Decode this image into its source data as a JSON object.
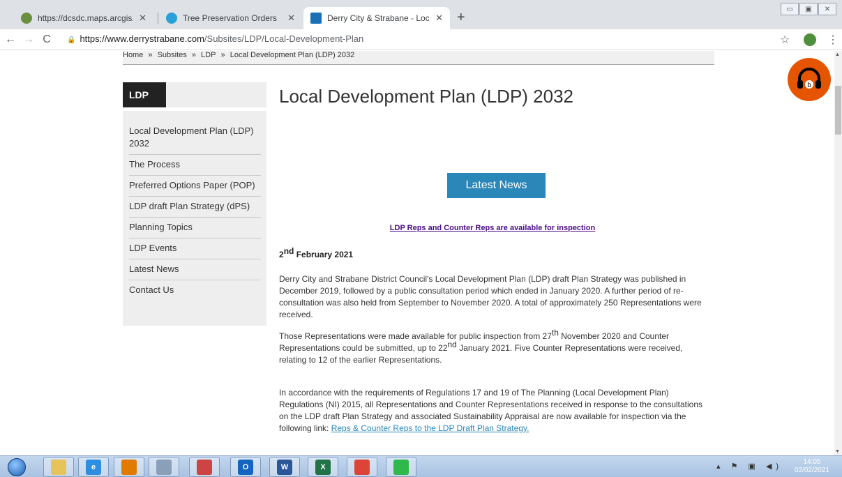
{
  "browser": {
    "tabs": [
      {
        "title": "https://dcsdc.maps.arcgis.com/ap",
        "color": "#6a8f3e"
      },
      {
        "title": "Tree Preservation Orders",
        "color": "#2aa0d8"
      },
      {
        "title": "Derry City & Strabane - Local De",
        "color": "#1a6fb5"
      }
    ],
    "new_tab": "+",
    "url_host": "https://www.derrystrabane.com",
    "url_path": "/Subsites/LDP/Local-Development-Plan"
  },
  "breadcrumb": [
    "Home",
    "»",
    "Subsites",
    "»",
    "LDP",
    "»",
    "Local Development Plan (LDP) 2032"
  ],
  "sidebar": {
    "heading": "LDP",
    "items": [
      "Local Development Plan (LDP) 2032",
      "The Process",
      "Preferred Options Paper (POP)",
      "LDP draft Plan Strategy (dPS)",
      "Planning Topics",
      "LDP Events",
      "Latest News",
      "Contact Us"
    ]
  },
  "main": {
    "title": "Local Development Plan (LDP) 2032",
    "news_button": "Latest News",
    "reps_link": "LDP Reps and Counter Reps are available for inspection",
    "date_day": "2",
    "date_suffix": "nd",
    "date_rest": "February 2021",
    "p1": "Derry City and Strabane District Council's Local Development Plan (LDP) draft Plan Strategy was published in December 2019, followed by a public consultation period which ended in January 2020. A further period of re-consultation was also held from September to November 2020. A total of approximately 250 Representations were received.",
    "p2_a": "Those Representations were made available for public inspection from 27",
    "p2_sup1": "th",
    "p2_b": " November 2020 and Counter Representations could be submitted, up to 22",
    "p2_sup2": "nd",
    "p2_c": " January 2021. Five Counter Representations were received, relating to 12 of the earlier Representations.",
    "p3_a": "In accordance with the requirements of Regulations 17 and 19 of The Planning (Local Development Plan) Regulations (NI) 2015, all Representations and Counter Representations received in response to the consultations on the LDP draft Plan Strategy and associated Sustainability Appraisal are now available for inspection via the following link: ",
    "p3_link": "Reps & Counter Reps to the LDP  Draft Plan Strategy."
  },
  "taskbar": {
    "time": "14:05",
    "date": "02/02/2021",
    "apps": [
      {
        "name": "explorer-icon",
        "label": "",
        "color": "#e8c25a"
      },
      {
        "name": "ie-icon",
        "label": "e",
        "color": "#2f8ee0"
      },
      {
        "name": "media-icon",
        "label": "",
        "color": "#e07b00"
      },
      {
        "name": "calculator-icon",
        "label": "",
        "color": "#8aa0b8"
      },
      {
        "name": "snipping-icon",
        "label": "",
        "color": "#c44"
      },
      {
        "name": "outlook-icon",
        "label": "O",
        "color": "#1565c0"
      },
      {
        "name": "word-icon",
        "label": "W",
        "color": "#2b579a"
      },
      {
        "name": "excel-icon",
        "label": "X",
        "color": "#217346"
      },
      {
        "name": "chrome-icon",
        "label": "",
        "color": "#db4437"
      },
      {
        "name": "update-icon",
        "label": "",
        "color": "#2fb84b"
      }
    ]
  },
  "colors": {
    "accent": "#2a87b8",
    "link_visited": "#4b0a8a",
    "audio_button": "#e55500"
  }
}
